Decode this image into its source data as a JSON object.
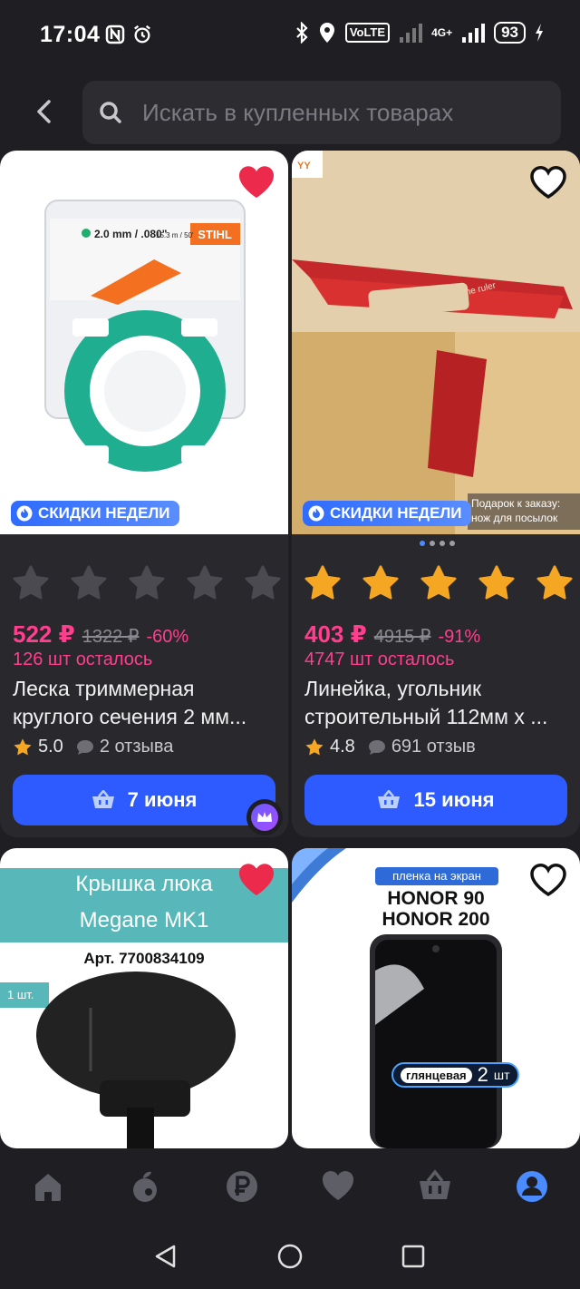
{
  "status_bar": {
    "time": "17:04",
    "volte": "VoLTE",
    "signal_label": "4G+",
    "battery": "93"
  },
  "search": {
    "placeholder": "Искать в купленных товарах"
  },
  "products": [
    {
      "badge": "СКИДКИ НЕДЕЛИ",
      "favorited": true,
      "rating_stars_filled": 0,
      "price": "522 ₽",
      "old_price": "1322 ₽",
      "discount": "-60%",
      "left_in_stock": "126 шт осталось",
      "title": "Леска триммерная круглого сечения 2 мм...",
      "rating": "5.0",
      "reviews": "2 отзыва",
      "delivery": "7 июня",
      "image_text": {
        "size": "2.0 mm / .080\"",
        "length": "15.3 m / 50'",
        "brand": "STIHL"
      }
    },
    {
      "badge": "СКИДКИ НЕДЕЛИ",
      "favorited": false,
      "rating_stars_filled": 5,
      "price": "403 ₽",
      "old_price": "4915 ₽",
      "discount": "-91%",
      "left_in_stock": "4747 шт осталось",
      "title": "Линейка, угольник строительный 112мм х ...",
      "rating": "4.8",
      "reviews": "691 отзыв",
      "delivery": "15 июня",
      "image_text": {
        "gift_line1": "Подарок к заказу:",
        "gift_line2": "нож для посылок",
        "ruler_text": "Drawing line ruler",
        "logo": "YY"
      }
    },
    {
      "favorited": true,
      "image_text": {
        "title_line1": "Крышка люка",
        "title_line2": "Megane MK1",
        "article": "Арт. 7700834109",
        "qty": "1 шт."
      }
    },
    {
      "favorited": false,
      "image_text": {
        "tag": "пленка на экран",
        "model1": "HONOR 90",
        "model2": "HONOR 200",
        "type": "глянцевая",
        "count": "2",
        "count_unit": "шт"
      }
    }
  ],
  "colors": {
    "background": "#1f1f23",
    "card": "#28282d",
    "accent_blue": "#2d5bff",
    "price_pink": "#ff3f8e",
    "star_gold": "#f5a623",
    "heart_red": "#ec2a4b"
  },
  "bottom_nav": [
    {
      "icon": "home-icon",
      "active": false
    },
    {
      "icon": "fruit-icon",
      "active": false
    },
    {
      "icon": "ruble-icon",
      "active": false
    },
    {
      "icon": "heart-icon",
      "active": false
    },
    {
      "icon": "basket-icon",
      "active": false
    },
    {
      "icon": "profile-icon",
      "active": true
    }
  ]
}
